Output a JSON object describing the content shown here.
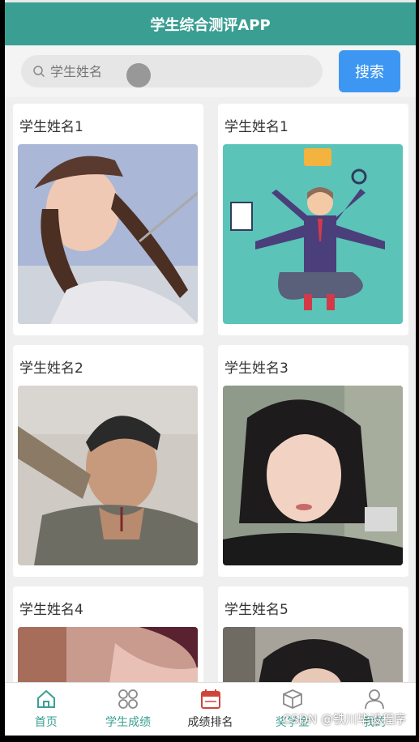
{
  "header": {
    "title": "学生综合测评APP"
  },
  "search": {
    "placeholder": "学生姓名",
    "button_label": "搜索"
  },
  "cards": [
    {
      "name": "学生姓名1",
      "image": "woman-in-cap-photo"
    },
    {
      "name": "学生姓名1",
      "image": "multitasking-businessman-illustration"
    },
    {
      "name": "学生姓名2",
      "image": "man-with-tattoos-photo"
    },
    {
      "name": "学生姓名3",
      "image": "woman-dark-hair-photo"
    },
    {
      "name": "学生姓名4",
      "image": "partial-photo"
    },
    {
      "name": "学生姓名5",
      "image": "partial-photo"
    }
  ],
  "tabbar": {
    "items": [
      {
        "label": "首页",
        "icon": "home-icon",
        "color": "#3a9f92"
      },
      {
        "label": "学生成绩",
        "icon": "grid-icon",
        "color": "#3a9f92"
      },
      {
        "label": "成绩排名",
        "icon": "calendar-icon",
        "color": "#333333"
      },
      {
        "label": "奖学金",
        "icon": "box-icon",
        "color": "#3a9f92"
      },
      {
        "label": "我的",
        "icon": "user-icon",
        "color": "#3a9f92"
      }
    ]
  },
  "watermark": "CSDN @铁川毕设程序",
  "colors": {
    "accent": "#3a9f92",
    "button": "#3d97f2"
  }
}
